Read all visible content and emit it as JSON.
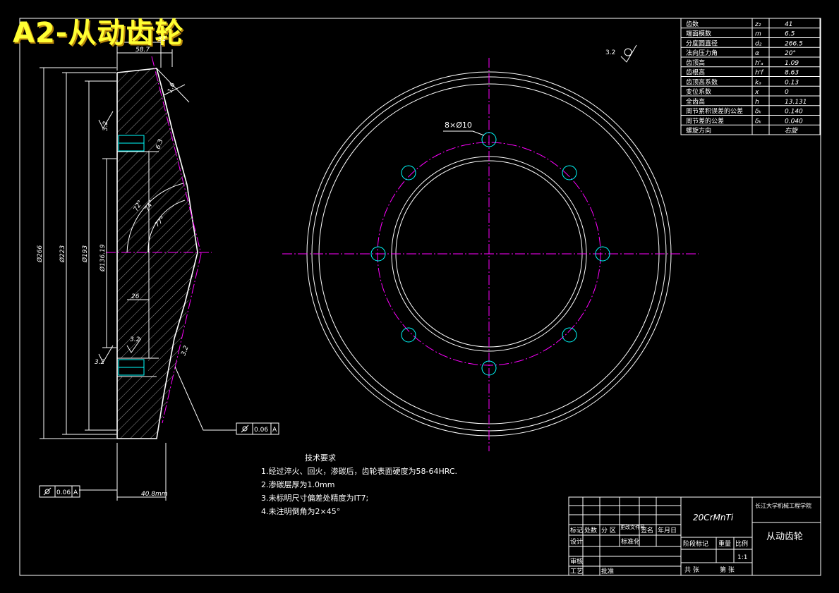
{
  "title": "A2-从动齿轮",
  "param_table": {
    "rows": [
      {
        "name": "齿数",
        "symbol": "z₂",
        "value": "41"
      },
      {
        "name": "端面模数",
        "symbol": "m",
        "value": "6.5"
      },
      {
        "name": "分度圆直径",
        "symbol": "d₂",
        "value": "266.5"
      },
      {
        "name": "法向压力角",
        "symbol": "α",
        "value": "20°"
      },
      {
        "name": "齿顶高",
        "symbol": "h'ₐ",
        "value": "1.09"
      },
      {
        "name": "齿根高",
        "symbol": "h'f",
        "value": "8.63"
      },
      {
        "name": "齿顶高系数",
        "symbol": "kₐ",
        "value": "0.13"
      },
      {
        "name": "变位系数",
        "symbol": "x",
        "value": "0"
      },
      {
        "name": "全齿高",
        "symbol": "h",
        "value": "13.131"
      },
      {
        "name": "周节累积误差的公差",
        "symbol": "δₖ",
        "value": "0.140"
      },
      {
        "name": "周节差的公差",
        "symbol": "δₖ",
        "value": "0.040"
      },
      {
        "name": "螺旋方向",
        "symbol": "",
        "value": "右旋"
      }
    ]
  },
  "section_view": {
    "dim_top_small": "31",
    "dim_top": "58.7",
    "dim_d266": "Ø266",
    "dim_d223": "Ø223",
    "dim_d193": "Ø193",
    "dim_d136": "Ø136.19",
    "dim_40": "40.8mm",
    "dim_26": "26",
    "roughness_a": "3.2",
    "roughness_b": "3.2",
    "roughness_c": "3.2",
    "roughness_d": "3.2",
    "roughness_e": "6.3",
    "roughness_f": "3.2",
    "angle_a": "72°",
    "angle_b": "77°",
    "angle_c": "74°",
    "chamfer_a": "1.6",
    "tolerance_1": "0.06",
    "tolerance_1_datum": "A",
    "tolerance_2": "0.06",
    "tolerance_2_datum": "A",
    "corner_roughness": "3.2"
  },
  "front_view": {
    "hole_label": "8×Ø10"
  },
  "tech_requirements": {
    "heading": "技术要求",
    "items": [
      "1.经过淬火、回火，渗碳后，齿轮表面硬度为58-64HRC.",
      "2.渗碳层厚为1.0mm",
      "3.未标明尺寸偏差处精度为IT7;",
      "4.未注明倒角为2×45°"
    ]
  },
  "title_block": {
    "material": "20CrMnTi",
    "school": "长江大学机械工程学院",
    "part_name": "从动齿轮",
    "labels": {
      "mark": "标记",
      "count": "处数",
      "zone": "分 区",
      "doc_no": "更改文件号",
      "sign": "签名",
      "date": "年月日",
      "design": "设计",
      "std": "标准化",
      "stage": "阶段标记",
      "weight": "重量",
      "ratio": "比例",
      "check": "审核",
      "craft": "工艺",
      "approve": "批准",
      "sheet_total": "共 张",
      "sheet_no": "第 张"
    },
    "scale": "1:1"
  }
}
